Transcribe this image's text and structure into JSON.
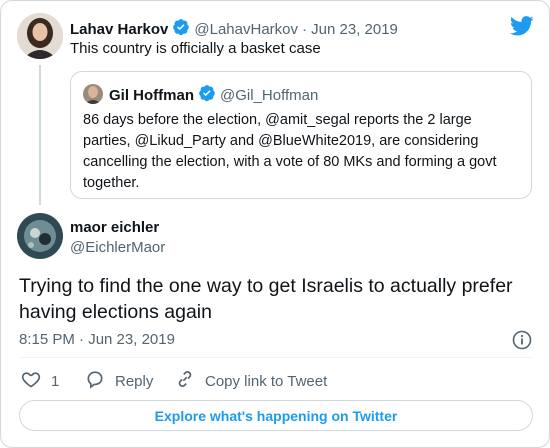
{
  "parent_tweet": {
    "display_name": "Lahav Harkov",
    "handle": "@LahavHarkov",
    "date": "· Jun 23, 2019",
    "text": "This country is officially a basket case"
  },
  "quoted_tweet": {
    "display_name": "Gil Hoffman",
    "handle": "@Gil_Hoffman",
    "text": "86 days before the election, @amit_segal reports the 2 large parties, @Likud_Party and @BlueWhite2019, are considering cancelling the election, with a vote of 80 MKs and forming a govt together."
  },
  "main_tweet": {
    "display_name": "maor eichler",
    "handle": "@EichlerMaor",
    "text": "Trying to find the one way to get Israelis to actually prefer having elections again",
    "timestamp": "8:15 PM · Jun 23, 2019"
  },
  "actions": {
    "like_count": "1",
    "reply_label": "Reply",
    "copy_link_label": "Copy link to Tweet"
  },
  "explore_label": "Explore what's happening on Twitter",
  "colors": {
    "accent": "#1d9bf0",
    "muted": "#536471",
    "border": "#cfd9de",
    "like_red": "#f91880"
  },
  "icons": [
    "twitter-bird-icon",
    "verified-badge-icon",
    "info-icon",
    "heart-icon",
    "reply-icon",
    "link-icon"
  ]
}
